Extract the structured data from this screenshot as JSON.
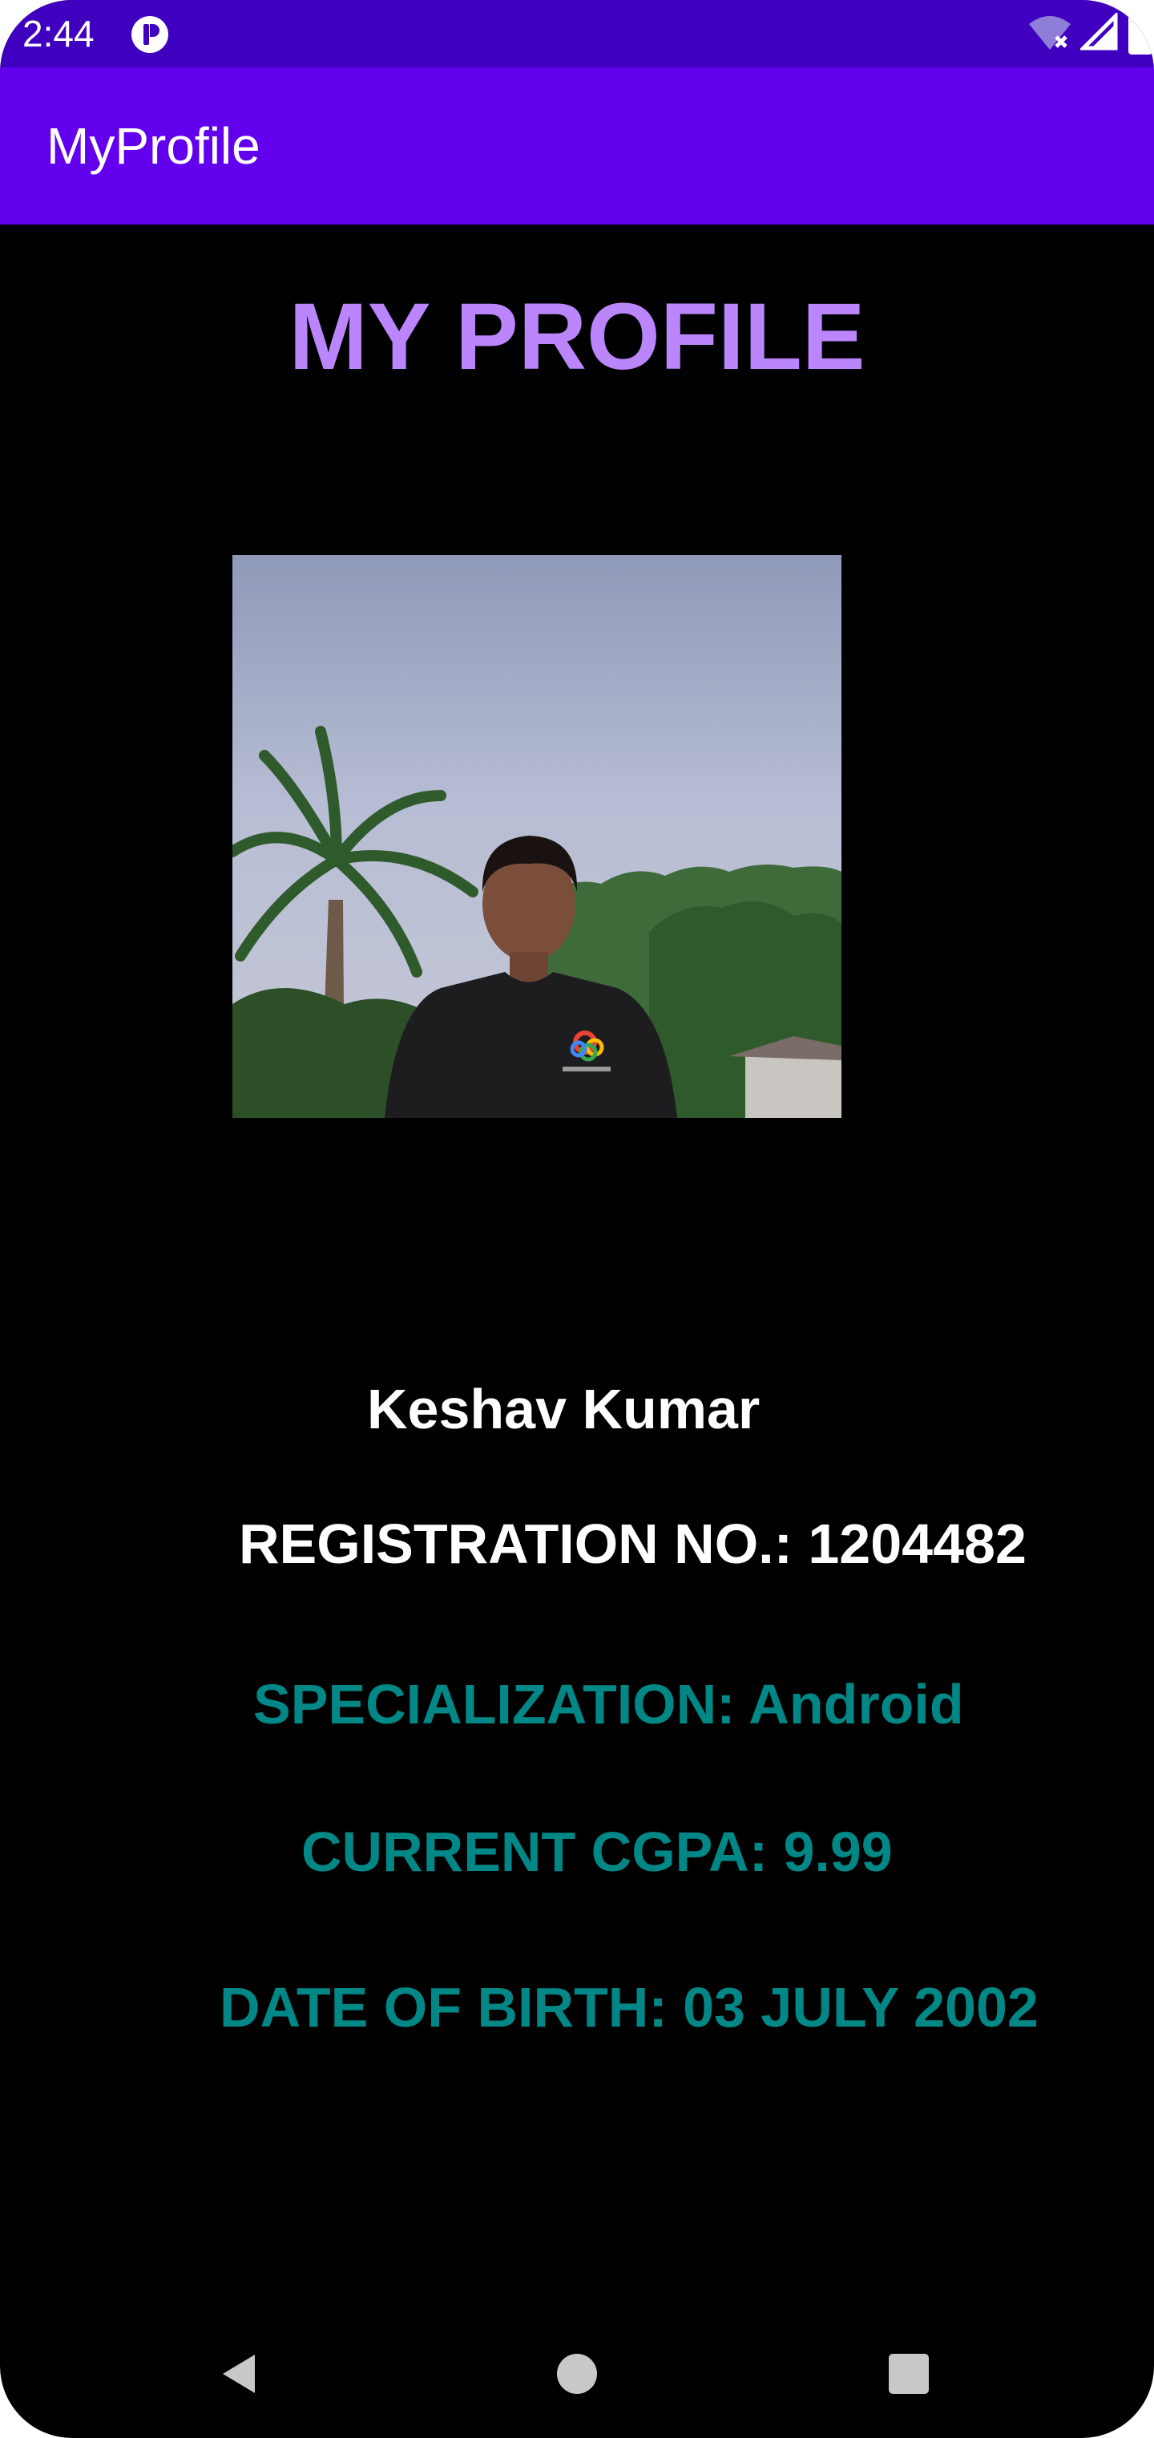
{
  "status_bar": {
    "time": "2:44",
    "icons": [
      "app-notification-icon",
      "wifi-off-icon",
      "cell-signal-icon",
      "battery-icon"
    ]
  },
  "app_bar": {
    "title": "MyProfile"
  },
  "profile": {
    "heading": "MY PROFILE",
    "name": "Keshav Kumar",
    "registration": "REGISTRATION NO.: 1204482",
    "specialization": "SPECIALIZATION: Android",
    "cgpa": "CURRENT CGPA: 9.99",
    "dob": "DATE OF BIRTH: 03 JULY 2002",
    "photo_alt": "profile-photo"
  },
  "nav_bar": {
    "icons": [
      "back-icon",
      "home-icon",
      "recents-icon"
    ]
  },
  "colors": {
    "status_bar": "#4000c0",
    "app_bar": "#6200ee",
    "heading": "#bb86fc",
    "primary_text": "#ffffff",
    "accent_text": "#018786",
    "background": "#000000"
  }
}
